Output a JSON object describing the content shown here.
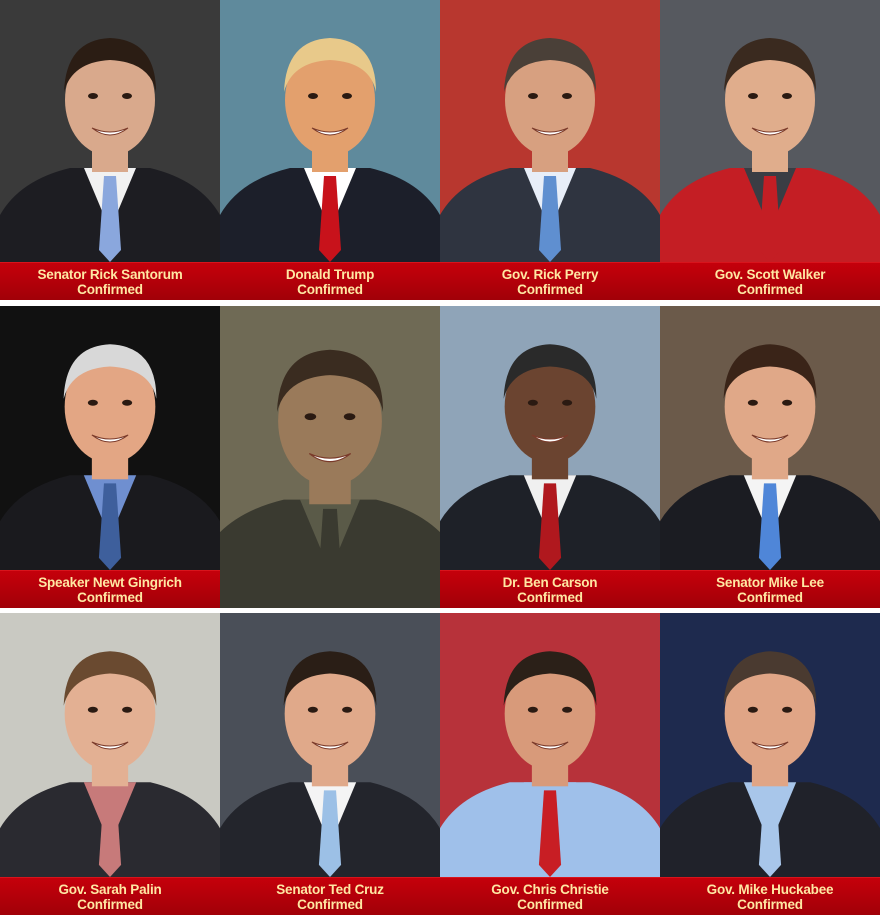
{
  "tiles": [
    {
      "name": "Senator Rick Santorum",
      "status": "Confirmed",
      "bg": "#3a3a3a",
      "skin": "#d9a98c",
      "hair": "#2b1d14",
      "suit": "#1d1d22",
      "tie": "#8aa7dd",
      "shirt": "#f1f1f1"
    },
    {
      "name": "Donald Trump",
      "status": "Confirmed",
      "bg": "#5f8a9c",
      "skin": "#e3a06d",
      "hair": "#e8c98a",
      "suit": "#1c1f2a",
      "tie": "#c8121b",
      "shirt": "#ffffff"
    },
    {
      "name": "Gov. Rick Perry",
      "status": "Confirmed",
      "bg": "#b8372f",
      "skin": "#d7a080",
      "hair": "#4a4038",
      "suit": "#2f3440",
      "tie": "#5f8fd0",
      "shirt": "#e8eef8"
    },
    {
      "name": "Gov. Scott Walker",
      "status": "Confirmed",
      "bg": "#56595f",
      "skin": "#e0ad8c",
      "hair": "#3a2a1f",
      "suit": "#c41e24",
      "tie": "#c41e24",
      "shirt": "#3a3d44"
    },
    {
      "name": "Speaker Newt Gingrich",
      "status": "Confirmed",
      "bg": "#111111",
      "skin": "#e3a684",
      "hair": "#d8d8d8",
      "suit": "#1a1a1e",
      "tie": "#3e5f9c",
      "shirt": "#6f8fd0"
    },
    {
      "name": "",
      "status": "",
      "bg": "#6f6a55",
      "skin": "#9a7a5a",
      "hair": "#3a2c20",
      "suit": "#3a3a30",
      "tie": "#3a3a30",
      "shirt": "#5a5a48"
    },
    {
      "name": "Dr. Ben Carson",
      "status": "Confirmed",
      "bg": "#8fa4b8",
      "skin": "#6b4430",
      "hair": "#2a2a2a",
      "suit": "#1e2128",
      "tie": "#b0181e",
      "shirt": "#f0f0f0"
    },
    {
      "name": "Senator Mike Lee",
      "status": "Confirmed",
      "bg": "#6b5a4a",
      "skin": "#e0a888",
      "hair": "#3a2418",
      "suit": "#1b1c22",
      "tie": "#4f86d8",
      "shirt": "#f4f4f4"
    },
    {
      "name": "Gov. Sarah Palin",
      "status": "Confirmed",
      "bg": "#c9c9c2",
      "skin": "#e3b093",
      "hair": "#6a4a30",
      "suit": "#2a2a30",
      "tie": "#c77a7a",
      "shirt": "#c77a7a"
    },
    {
      "name": "Senator Ted Cruz",
      "status": "Confirmed",
      "bg": "#4a4f58",
      "skin": "#e0a98a",
      "hair": "#2a1e16",
      "suit": "#23252c",
      "tie": "#9cc0e6",
      "shirt": "#f4f4f4"
    },
    {
      "name": "Gov. Chris Christie",
      "status": "Confirmed",
      "bg": "#b7323a",
      "skin": "#d89a7a",
      "hair": "#2b2018",
      "suit": "#9fc0ea",
      "tie": "#c81e24",
      "shirt": "#9fc0ea"
    },
    {
      "name": "Gov. Mike Huckabee",
      "status": "Confirmed",
      "bg": "#1e2a4e",
      "skin": "#e0a586",
      "hair": "#4a3a30",
      "suit": "#20222a",
      "tie": "#a8c6ea",
      "shirt": "#a8c6ea"
    }
  ],
  "caption_colors": {
    "bar": "#b1000a",
    "text": "#ffe7a3"
  }
}
